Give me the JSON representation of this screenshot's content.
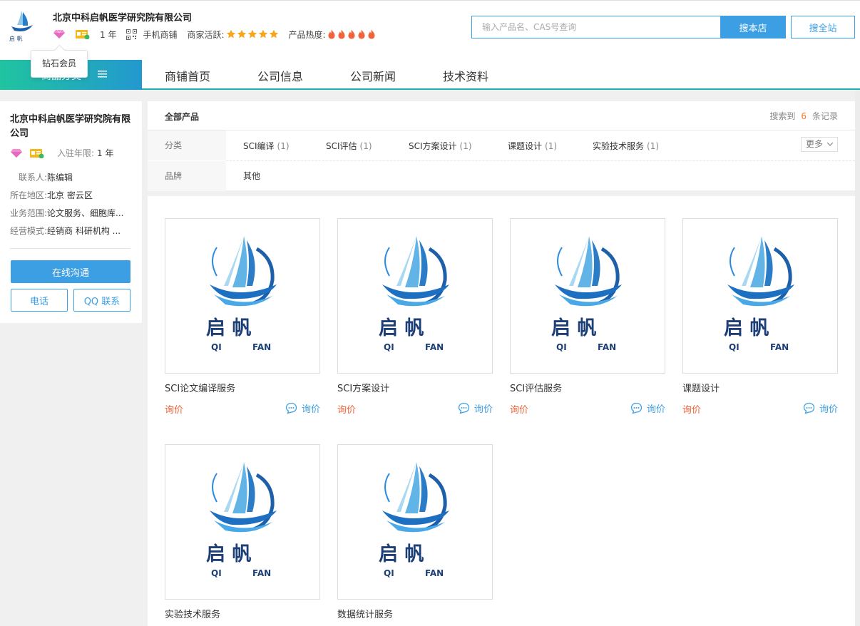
{
  "header": {
    "company_name": "北京中科启帆医学研究院有限公司",
    "logo_text": "启 帆",
    "years": "1 年",
    "mobile_store": "手机商铺",
    "activity_label": "商家活跃:",
    "activity_stars": 5,
    "heat_label": "产品热度:",
    "heat_flames": 5,
    "tooltip": "钻石会员",
    "search_placeholder": "输入产品名、CAS号查询",
    "search_store": "搜本店",
    "search_site": "搜全站",
    "accent_color": "#3c9fe4"
  },
  "nav": {
    "category_label": "商品分类",
    "items": [
      "商铺首页",
      "公司信息",
      "公司新闻",
      "技术资料"
    ]
  },
  "sidebar": {
    "company_name": "北京中科启帆医学研究院有限公司",
    "tenure_label": "入驻年限:",
    "tenure_value": "1 年",
    "info": [
      {
        "key": "联系人:",
        "value": "陈编辑"
      },
      {
        "key": "所在地区:",
        "value": "北京 密云区"
      },
      {
        "key": "业务范围:",
        "value": "论文服务、细胞库..."
      },
      {
        "key": "经营模式:",
        "value": "经销商 科研机构 ..."
      }
    ],
    "chat_button": "在线沟通",
    "phone_button": "电话",
    "qq_button": "QQ 联系"
  },
  "filter": {
    "title": "全部产品",
    "count_prefix": "搜索到",
    "count": "6",
    "count_suffix": "条记录",
    "category_label": "分类",
    "categories": [
      {
        "name": "SCI编译",
        "count": "(1)"
      },
      {
        "name": "SCI评估",
        "count": "(1)"
      },
      {
        "name": "SCI方案设计",
        "count": "(1)"
      },
      {
        "name": "课题设计",
        "count": "(1)"
      },
      {
        "name": "实验技术服务",
        "count": "(1)"
      }
    ],
    "more_label": "更多",
    "brand_label": "品牌",
    "brand_value": "其他"
  },
  "products": {
    "price_text": "询价",
    "inquiry_text": "询价",
    "logo_cn": "启  帆",
    "logo_en_left": "QI",
    "logo_en_right": "FAN",
    "items": [
      {
        "name": "SCI论文编译服务"
      },
      {
        "name": "SCI方案设计"
      },
      {
        "name": "SCI评估服务"
      },
      {
        "name": "课题设计"
      },
      {
        "name": "实验技术服务"
      },
      {
        "name": "数据统计服务"
      }
    ]
  }
}
